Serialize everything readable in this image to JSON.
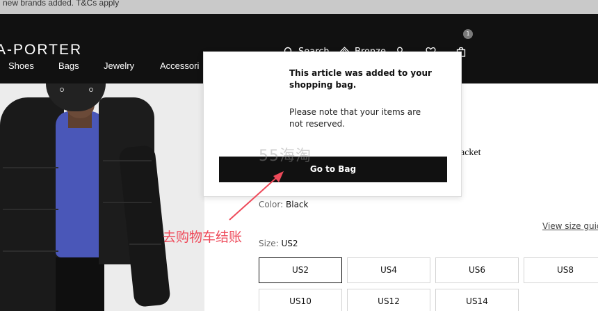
{
  "promo_banner": {
    "text": "new brands added. T&Cs apply"
  },
  "header": {
    "logo": "A-PORTER",
    "search_label": "Search",
    "rewards_label": "Bronze",
    "bag_count": "1"
  },
  "nav": {
    "items": [
      "Shoes",
      "Bags",
      "Jewelry",
      "Accessori"
    ]
  },
  "product": {
    "title_fragment": "acket",
    "color_label": "Color:",
    "color_value": "Black",
    "size_guide": "View size guid",
    "size_label": "Size:",
    "size_value": "US2",
    "sizes": [
      "US2",
      "US4",
      "US6",
      "US8",
      "US10",
      "US12",
      "US14"
    ],
    "selected_size": "US2"
  },
  "popup": {
    "message": "This article was added to your shopping bag.",
    "note": "Please note that your items are not reserved.",
    "button_label": "Go to Bag"
  },
  "watermark": "55海淘",
  "annotation": {
    "text": "去购物车结账",
    "color": "#ee4a5a"
  },
  "colors": {
    "header_bg": "#111111",
    "promo_bg": "#c9c9c9",
    "button_bg": "#111111"
  }
}
